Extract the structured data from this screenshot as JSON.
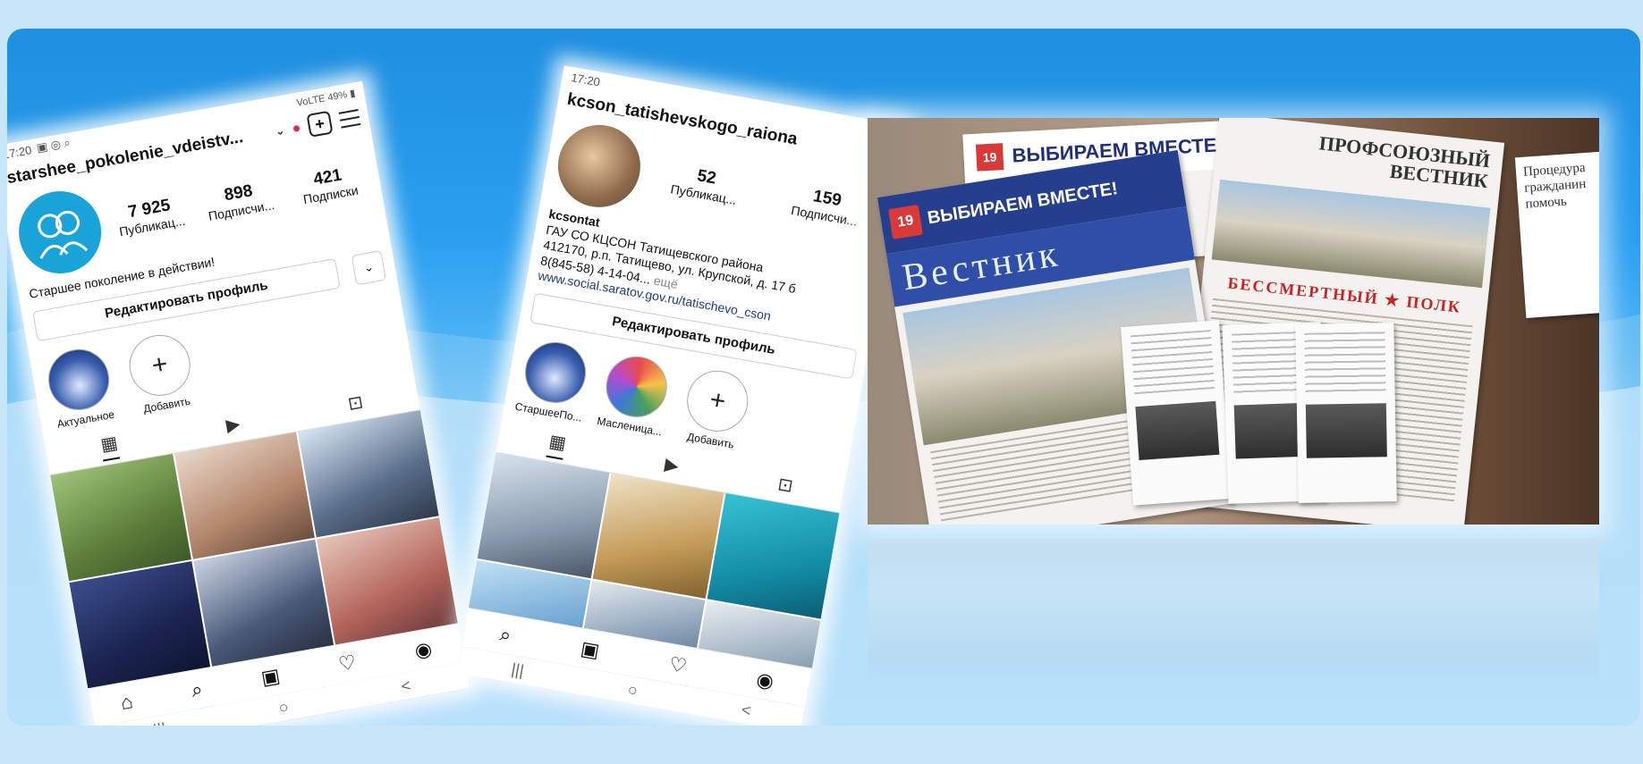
{
  "phone_left": {
    "status_time": "17:20",
    "status_icons_right": "VoLTE 49% ▮",
    "username": "starshee_pokolenie_vdeistv...",
    "add_icon": "plus-square-icon",
    "menu_icon": "hamburger-icon",
    "stats": [
      {
        "value": "7 925",
        "label": "Публикац..."
      },
      {
        "value": "898",
        "label": "Подписчи..."
      },
      {
        "value": "421",
        "label": "Подписки"
      }
    ],
    "bio_line": "Старшее поколение в действии!",
    "edit_profile": "Редактировать профиль",
    "highlights": [
      {
        "label": "Актуальное"
      },
      {
        "label": "Добавить",
        "symbol": "+"
      }
    ],
    "nav": [
      "home-icon",
      "search-icon",
      "reels-icon",
      "heart-icon",
      "profile-icon"
    ],
    "sys": [
      "|||",
      "○",
      "<"
    ]
  },
  "phone_right": {
    "status_time": "17:20",
    "username": "kcson_tatishevskogo_raiona",
    "stats": [
      {
        "value": "52",
        "label": "Публикац..."
      },
      {
        "value": "159",
        "label": "Подписчи..."
      }
    ],
    "bio_name": "kcsontat",
    "bio_lines": [
      "ГАУ СО КЦСОН Татищевского района",
      "412170, р.п. Татищево, ул. Крупской, д. 17 б",
      "8(845-58) 4-14-04..."
    ],
    "bio_more": "ещё",
    "bio_link": "www.social.saratov.gov.ru/tatischevo_cson",
    "edit_profile": "Редактировать профиль",
    "highlights": [
      {
        "label": "СтаршееПо..."
      },
      {
        "label": "Масленица..."
      },
      {
        "label": "Добавить",
        "symbol": "+"
      }
    ],
    "sys": [
      "|||",
      "○",
      "<"
    ]
  },
  "newspapers": {
    "vestnik_badge": "19",
    "vestnik_header": "ВЫБИРАЕМ ВМЕСТЕ!",
    "vestnik_title": "Вестник",
    "back_header": "ВЫБИРАЕМ ВМЕСТЕ!",
    "prof_title_1": "ПРОФСОЮЗНЫЙ",
    "prof_title_2": "ВЕСТНИК",
    "prof_red": "БЕССМЕРТНЫЙ ★ ПОЛК",
    "right_text": "Процедура гражданин помочь"
  }
}
